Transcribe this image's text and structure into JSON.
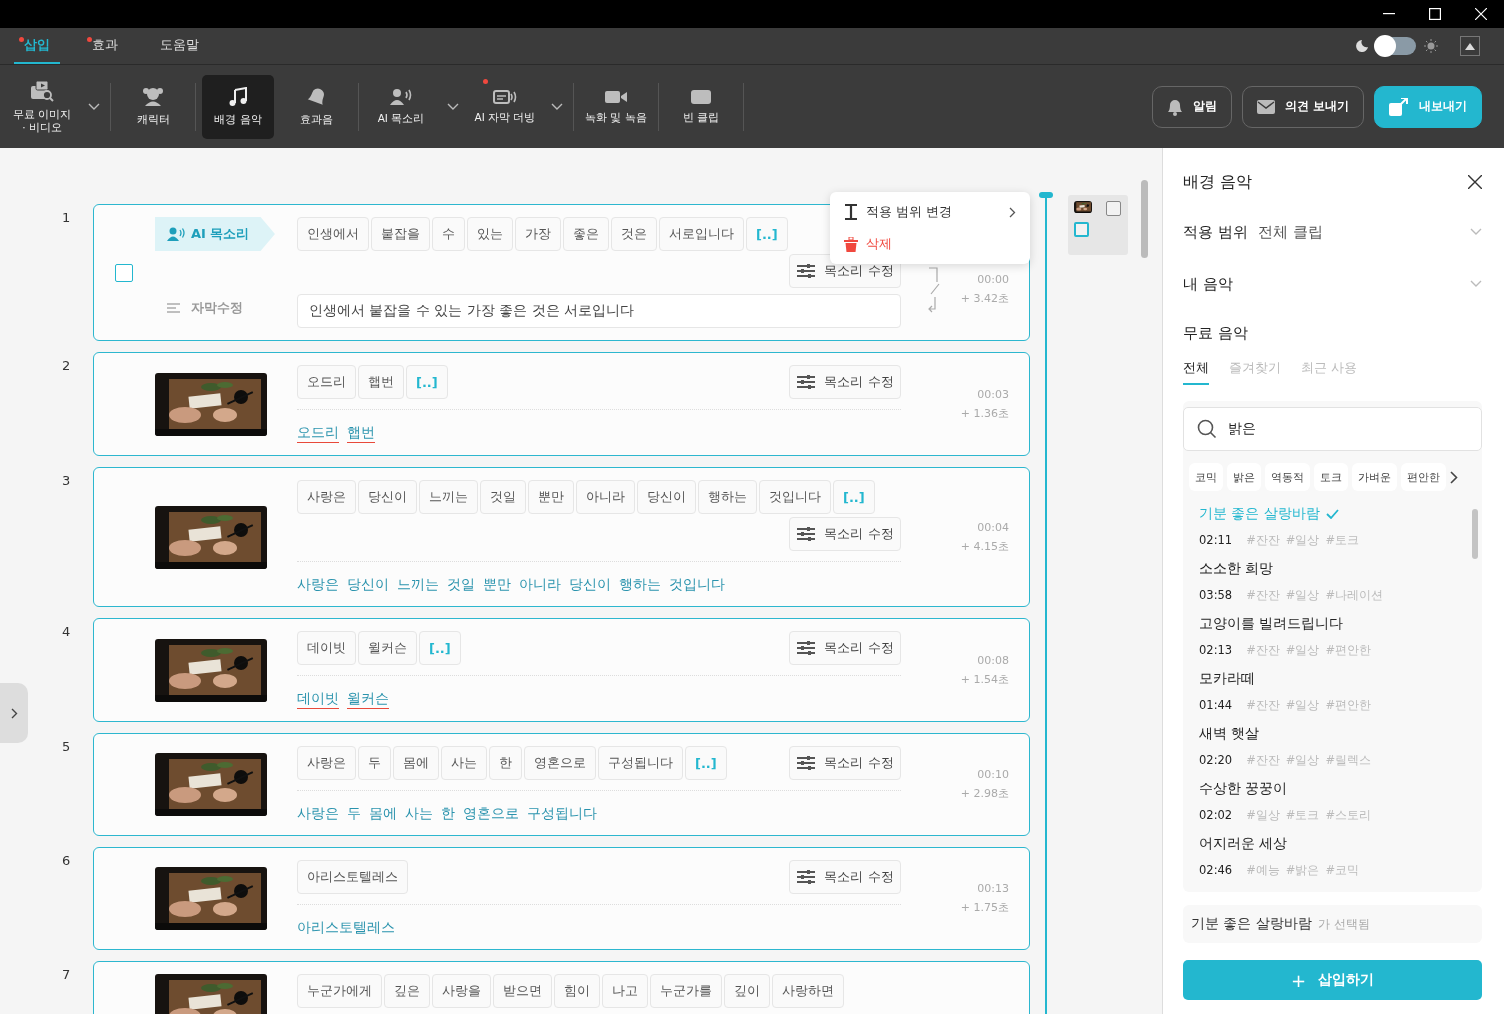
{
  "menu_tabs": [
    {
      "label": "삽입",
      "selected": true,
      "badge": true
    },
    {
      "label": "효과",
      "selected": false,
      "badge": true
    },
    {
      "label": "도움말",
      "selected": false,
      "badge": false
    }
  ],
  "theme_toggle": {
    "on": false
  },
  "toolbar": {
    "tool_groups": [
      {
        "tools": [
          {
            "label": "무료 이미지 · 비디오",
            "selected": false,
            "dropdown": true,
            "badge": false
          }
        ]
      },
      {
        "tools": [
          {
            "label": "캐릭터",
            "selected": false,
            "dropdown": false,
            "badge": false
          }
        ]
      },
      {
        "tools": [
          {
            "label": "배경 음악",
            "selected": true,
            "dropdown": false,
            "badge": false
          },
          {
            "label": "효과음",
            "selected": false,
            "dropdown": false,
            "badge": false
          }
        ]
      },
      {
        "tools": [
          {
            "label": "AI 목소리",
            "selected": false,
            "dropdown": true,
            "badge": false
          },
          {
            "label": "AI 자막 더빙",
            "selected": false,
            "dropdown": true,
            "badge": true
          }
        ]
      },
      {
        "tools": [
          {
            "label": "녹화 및 녹음",
            "selected": false,
            "dropdown": false,
            "badge": false
          }
        ]
      },
      {
        "tools": [
          {
            "label": "빈 클립",
            "selected": false,
            "dropdown": false,
            "badge": false
          }
        ]
      }
    ],
    "actions": [
      {
        "label": "알림",
        "kind": "outline"
      },
      {
        "label": "의견 보내기",
        "kind": "outline"
      },
      {
        "label": "내보내기",
        "kind": "primary"
      }
    ]
  },
  "clips": [
    {
      "number": "1",
      "kind": "ai_voice",
      "voice_tag": "AI 목소리",
      "checked": false,
      "subtitle_label": "자막수정",
      "words": [
        "인생에서",
        "붙잡을",
        "수",
        "있는",
        "가장",
        "좋은",
        "것은",
        "서로입니다"
      ],
      "pause_chip": "[..]",
      "voice_button": "목소리 수정",
      "time": "00:00",
      "duration": "+  3.42초",
      "subtitle_value": "인생에서 붙잡을 수 있는 가장 좋은 것은 서로입니다"
    },
    {
      "number": "2",
      "kind": "video",
      "words": [
        "오드리",
        "햅번"
      ],
      "pause_chip": "[..]",
      "voice_button": "목소리 수정",
      "time": "00:03",
      "duration": "+  1.36초",
      "subtitle_words": [
        {
          "text": "오드리",
          "flagged": true
        },
        {
          "text": "햅번",
          "flagged": true
        }
      ]
    },
    {
      "number": "3",
      "kind": "video",
      "words": [
        "사랑은",
        "당신이",
        "느끼는",
        "것일",
        "뿐만",
        "아니라",
        "당신이",
        "행하는",
        "것입니다"
      ],
      "pause_chip": "[..]",
      "voice_button": "목소리 수정",
      "time": "00:04",
      "duration": "+  4.15초",
      "subtitle_words": [
        {
          "text": "사랑은",
          "flagged": false
        },
        {
          "text": "당신이",
          "flagged": false
        },
        {
          "text": "느끼는",
          "flagged": false
        },
        {
          "text": "것일",
          "flagged": false
        },
        {
          "text": "뿐만",
          "flagged": false
        },
        {
          "text": "아니라",
          "flagged": false
        },
        {
          "text": "당신이",
          "flagged": false
        },
        {
          "text": "행하는",
          "flagged": false
        },
        {
          "text": "것입니다",
          "flagged": false
        }
      ]
    },
    {
      "number": "4",
      "kind": "video",
      "words": [
        "데이빗",
        "윌커슨"
      ],
      "pause_chip": "[..]",
      "voice_button": "목소리 수정",
      "time": "00:08",
      "duration": "+  1.54초",
      "subtitle_words": [
        {
          "text": "데이빗",
          "flagged": true
        },
        {
          "text": "윌커슨",
          "flagged": true
        }
      ]
    },
    {
      "number": "5",
      "kind": "video",
      "words": [
        "사랑은",
        "두",
        "몸에",
        "사는",
        "한",
        "영혼으로",
        "구성됩니다"
      ],
      "pause_chip": "[..]",
      "voice_button": "목소리 수정",
      "time": "00:10",
      "duration": "+  2.98초",
      "subtitle_words": [
        {
          "text": "사랑은",
          "flagged": false
        },
        {
          "text": "두",
          "flagged": false
        },
        {
          "text": "몸에",
          "flagged": false
        },
        {
          "text": "사는",
          "flagged": false
        },
        {
          "text": "한",
          "flagged": false
        },
        {
          "text": "영혼으로",
          "flagged": false
        },
        {
          "text": "구성됩니다",
          "flagged": false
        }
      ]
    },
    {
      "number": "6",
      "kind": "video",
      "words": [
        "아리스토텔레스"
      ],
      "voice_button": "목소리 수정",
      "time": "00:13",
      "duration": "+  1.75초",
      "subtitle_words": [
        {
          "text": "아리스토텔레스",
          "flagged": false
        }
      ]
    },
    {
      "number": "7",
      "kind": "video",
      "words": [
        "누군가에게",
        "깊은",
        "사랑을",
        "받으면",
        "힘이",
        "나고",
        "누군가를",
        "깊이",
        "사랑하면"
      ]
    }
  ],
  "context_menu": {
    "items": [
      {
        "label": "적용 범위 변경",
        "kind": "submenu"
      },
      {
        "label": "삭제",
        "kind": "danger"
      }
    ]
  },
  "mini_panel": {
    "checkboxes": [
      {
        "selected": false
      },
      {
        "selected": true
      }
    ]
  },
  "panel": {
    "title": "배경 음악",
    "scope": {
      "label": "적용 범위",
      "value": "전체 클립"
    },
    "my_music": {
      "label": "내 음악"
    },
    "free_music": {
      "label": "무료 음악"
    },
    "tabs": [
      {
        "label": "전체",
        "selected": true
      },
      {
        "label": "즐겨찾기",
        "selected": false
      },
      {
        "label": "최근 사용",
        "selected": false
      }
    ],
    "search": {
      "value": "밝은"
    },
    "categories": [
      "코믹",
      "밝은",
      "역동적",
      "토크",
      "가벼운",
      "편안한"
    ],
    "tracks": [
      {
        "title": "기분 좋은 살랑바람",
        "duration": "02:11",
        "tags": [
          "#잔잔",
          "#일상",
          "#토크"
        ],
        "selected": true
      },
      {
        "title": "소소한 희망",
        "duration": "03:58",
        "tags": [
          "#잔잔",
          "#일상",
          "#나레이션"
        ],
        "selected": false
      },
      {
        "title": "고양이를 빌려드립니다",
        "duration": "02:13",
        "tags": [
          "#잔잔",
          "#일상",
          "#편안한"
        ],
        "selected": false
      },
      {
        "title": "모카라떼",
        "duration": "01:44",
        "tags": [
          "#잔잔",
          "#일상",
          "#편안한"
        ],
        "selected": false
      },
      {
        "title": "새벽 햇살",
        "duration": "02:20",
        "tags": [
          "#잔잔",
          "#일상",
          "#릴렉스"
        ],
        "selected": false
      },
      {
        "title": "수상한 꿍꿍이",
        "duration": "02:02",
        "tags": [
          "#일상",
          "#토크",
          "#스토리"
        ],
        "selected": false
      },
      {
        "title": "어지러운 세상",
        "duration": "02:46",
        "tags": [
          "#예능",
          "#밝은",
          "#코믹"
        ],
        "selected": false
      }
    ],
    "selection": {
      "title": "기분 좋은 살랑바람",
      "suffix": "가 선택됨"
    },
    "insert_button": {
      "icon": "+",
      "label": "삽입하기"
    }
  }
}
